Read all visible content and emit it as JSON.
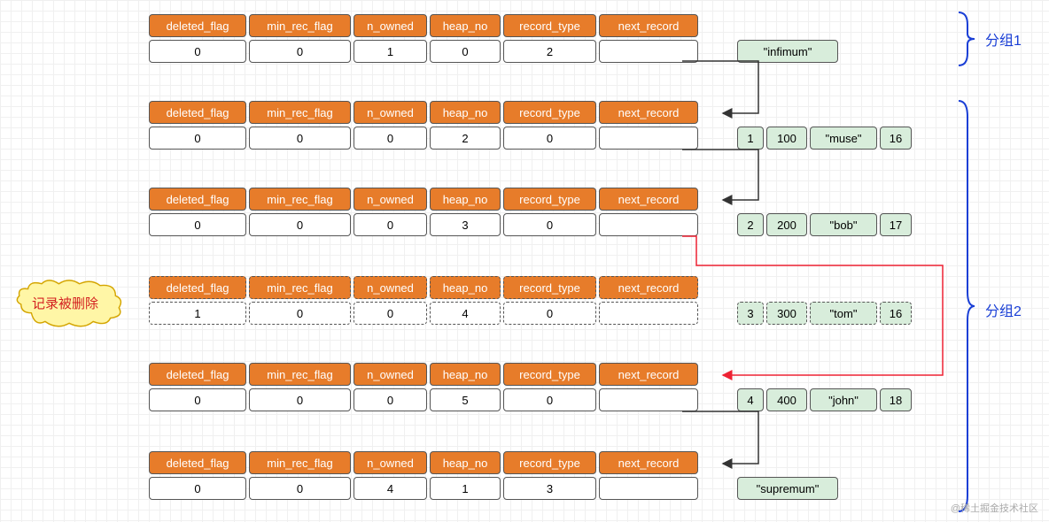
{
  "headers": {
    "deleted_flag": "deleted_flag",
    "min_rec_flag": "min_rec_flag",
    "n_owned": "n_owned",
    "heap_no": "heap_no",
    "record_type": "record_type",
    "next_record": "next_record"
  },
  "records": [
    {
      "deleted_flag": "0",
      "min_rec_flag": "0",
      "n_owned": "1",
      "heap_no": "0",
      "record_type": "2",
      "next_record": "",
      "data": [
        "\"infimum\""
      ],
      "deleted": false
    },
    {
      "deleted_flag": "0",
      "min_rec_flag": "0",
      "n_owned": "0",
      "heap_no": "2",
      "record_type": "0",
      "next_record": "",
      "data": [
        "1",
        "100",
        "\"muse\"",
        "16"
      ],
      "deleted": false
    },
    {
      "deleted_flag": "0",
      "min_rec_flag": "0",
      "n_owned": "0",
      "heap_no": "3",
      "record_type": "0",
      "next_record": "",
      "data": [
        "2",
        "200",
        "\"bob\"",
        "17"
      ],
      "deleted": false
    },
    {
      "deleted_flag": "1",
      "min_rec_flag": "0",
      "n_owned": "0",
      "heap_no": "4",
      "record_type": "0",
      "next_record": "",
      "data": [
        "3",
        "300",
        "\"tom\"",
        "16"
      ],
      "deleted": true
    },
    {
      "deleted_flag": "0",
      "min_rec_flag": "0",
      "n_owned": "0",
      "heap_no": "5",
      "record_type": "0",
      "next_record": "",
      "data": [
        "4",
        "400",
        "\"john\"",
        "18"
      ],
      "deleted": false
    },
    {
      "deleted_flag": "0",
      "min_rec_flag": "0",
      "n_owned": "4",
      "heap_no": "1",
      "record_type": "3",
      "next_record": "",
      "data": [
        "\"supremum\""
      ],
      "deleted": false
    }
  ],
  "callout": "记录被删除",
  "groups": {
    "g1": "分组1",
    "g2": "分组2"
  },
  "footer": "@稀土掘金技术社区"
}
